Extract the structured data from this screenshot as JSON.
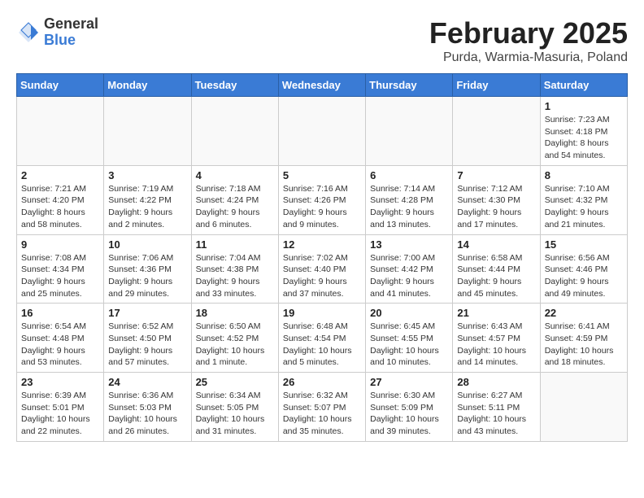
{
  "header": {
    "logo_general": "General",
    "logo_blue": "Blue",
    "month": "February 2025",
    "location": "Purda, Warmia-Masuria, Poland"
  },
  "weekdays": [
    "Sunday",
    "Monday",
    "Tuesday",
    "Wednesday",
    "Thursday",
    "Friday",
    "Saturday"
  ],
  "weeks": [
    [
      {
        "day": "",
        "info": ""
      },
      {
        "day": "",
        "info": ""
      },
      {
        "day": "",
        "info": ""
      },
      {
        "day": "",
        "info": ""
      },
      {
        "day": "",
        "info": ""
      },
      {
        "day": "",
        "info": ""
      },
      {
        "day": "1",
        "info": "Sunrise: 7:23 AM\nSunset: 4:18 PM\nDaylight: 8 hours and 54 minutes."
      }
    ],
    [
      {
        "day": "2",
        "info": "Sunrise: 7:21 AM\nSunset: 4:20 PM\nDaylight: 8 hours and 58 minutes."
      },
      {
        "day": "3",
        "info": "Sunrise: 7:19 AM\nSunset: 4:22 PM\nDaylight: 9 hours and 2 minutes."
      },
      {
        "day": "4",
        "info": "Sunrise: 7:18 AM\nSunset: 4:24 PM\nDaylight: 9 hours and 6 minutes."
      },
      {
        "day": "5",
        "info": "Sunrise: 7:16 AM\nSunset: 4:26 PM\nDaylight: 9 hours and 9 minutes."
      },
      {
        "day": "6",
        "info": "Sunrise: 7:14 AM\nSunset: 4:28 PM\nDaylight: 9 hours and 13 minutes."
      },
      {
        "day": "7",
        "info": "Sunrise: 7:12 AM\nSunset: 4:30 PM\nDaylight: 9 hours and 17 minutes."
      },
      {
        "day": "8",
        "info": "Sunrise: 7:10 AM\nSunset: 4:32 PM\nDaylight: 9 hours and 21 minutes."
      }
    ],
    [
      {
        "day": "9",
        "info": "Sunrise: 7:08 AM\nSunset: 4:34 PM\nDaylight: 9 hours and 25 minutes."
      },
      {
        "day": "10",
        "info": "Sunrise: 7:06 AM\nSunset: 4:36 PM\nDaylight: 9 hours and 29 minutes."
      },
      {
        "day": "11",
        "info": "Sunrise: 7:04 AM\nSunset: 4:38 PM\nDaylight: 9 hours and 33 minutes."
      },
      {
        "day": "12",
        "info": "Sunrise: 7:02 AM\nSunset: 4:40 PM\nDaylight: 9 hours and 37 minutes."
      },
      {
        "day": "13",
        "info": "Sunrise: 7:00 AM\nSunset: 4:42 PM\nDaylight: 9 hours and 41 minutes."
      },
      {
        "day": "14",
        "info": "Sunrise: 6:58 AM\nSunset: 4:44 PM\nDaylight: 9 hours and 45 minutes."
      },
      {
        "day": "15",
        "info": "Sunrise: 6:56 AM\nSunset: 4:46 PM\nDaylight: 9 hours and 49 minutes."
      }
    ],
    [
      {
        "day": "16",
        "info": "Sunrise: 6:54 AM\nSunset: 4:48 PM\nDaylight: 9 hours and 53 minutes."
      },
      {
        "day": "17",
        "info": "Sunrise: 6:52 AM\nSunset: 4:50 PM\nDaylight: 9 hours and 57 minutes."
      },
      {
        "day": "18",
        "info": "Sunrise: 6:50 AM\nSunset: 4:52 PM\nDaylight: 10 hours and 1 minute."
      },
      {
        "day": "19",
        "info": "Sunrise: 6:48 AM\nSunset: 4:54 PM\nDaylight: 10 hours and 5 minutes."
      },
      {
        "day": "20",
        "info": "Sunrise: 6:45 AM\nSunset: 4:55 PM\nDaylight: 10 hours and 10 minutes."
      },
      {
        "day": "21",
        "info": "Sunrise: 6:43 AM\nSunset: 4:57 PM\nDaylight: 10 hours and 14 minutes."
      },
      {
        "day": "22",
        "info": "Sunrise: 6:41 AM\nSunset: 4:59 PM\nDaylight: 10 hours and 18 minutes."
      }
    ],
    [
      {
        "day": "23",
        "info": "Sunrise: 6:39 AM\nSunset: 5:01 PM\nDaylight: 10 hours and 22 minutes."
      },
      {
        "day": "24",
        "info": "Sunrise: 6:36 AM\nSunset: 5:03 PM\nDaylight: 10 hours and 26 minutes."
      },
      {
        "day": "25",
        "info": "Sunrise: 6:34 AM\nSunset: 5:05 PM\nDaylight: 10 hours and 31 minutes."
      },
      {
        "day": "26",
        "info": "Sunrise: 6:32 AM\nSunset: 5:07 PM\nDaylight: 10 hours and 35 minutes."
      },
      {
        "day": "27",
        "info": "Sunrise: 6:30 AM\nSunset: 5:09 PM\nDaylight: 10 hours and 39 minutes."
      },
      {
        "day": "28",
        "info": "Sunrise: 6:27 AM\nSunset: 5:11 PM\nDaylight: 10 hours and 43 minutes."
      },
      {
        "day": "",
        "info": ""
      }
    ]
  ]
}
